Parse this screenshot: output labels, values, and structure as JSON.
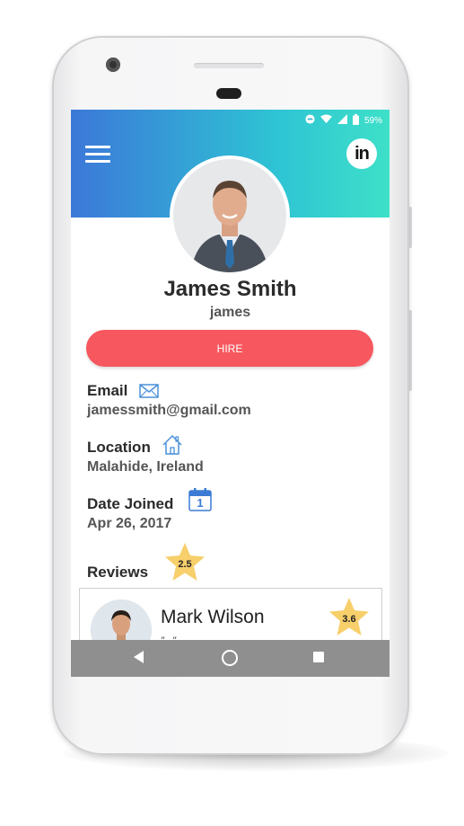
{
  "status_bar": {
    "battery_text": "59%"
  },
  "profile": {
    "name": "James Smith",
    "username": "james",
    "hire_label": "HIRE"
  },
  "fields": {
    "email_label": "Email",
    "email_value": "jamessmith@gmail.com",
    "location_label": "Location",
    "location_value": "Malahide, Ireland",
    "date_label": "Date Joined",
    "date_value": "Apr 26, 2017",
    "calendar_day": "1"
  },
  "reviews": {
    "label": "Reviews",
    "average_rating": "2.5",
    "items": [
      {
        "reviewer_name": "Mark Wilson",
        "rating": "3.6",
        "text": "\"...\""
      }
    ]
  },
  "colors": {
    "header_gradient_start": "#3c78d8",
    "header_gradient_end": "#3ee0c8",
    "hire_button": "#f7575e",
    "star": "#f7cf6b",
    "navbar": "#8f8f8f"
  },
  "icons": {
    "menu": "hamburger-icon",
    "linkedin": "linkedin-icon",
    "email": "envelope-icon",
    "location": "house-icon",
    "date": "calendar-icon",
    "rating": "star-icon"
  }
}
